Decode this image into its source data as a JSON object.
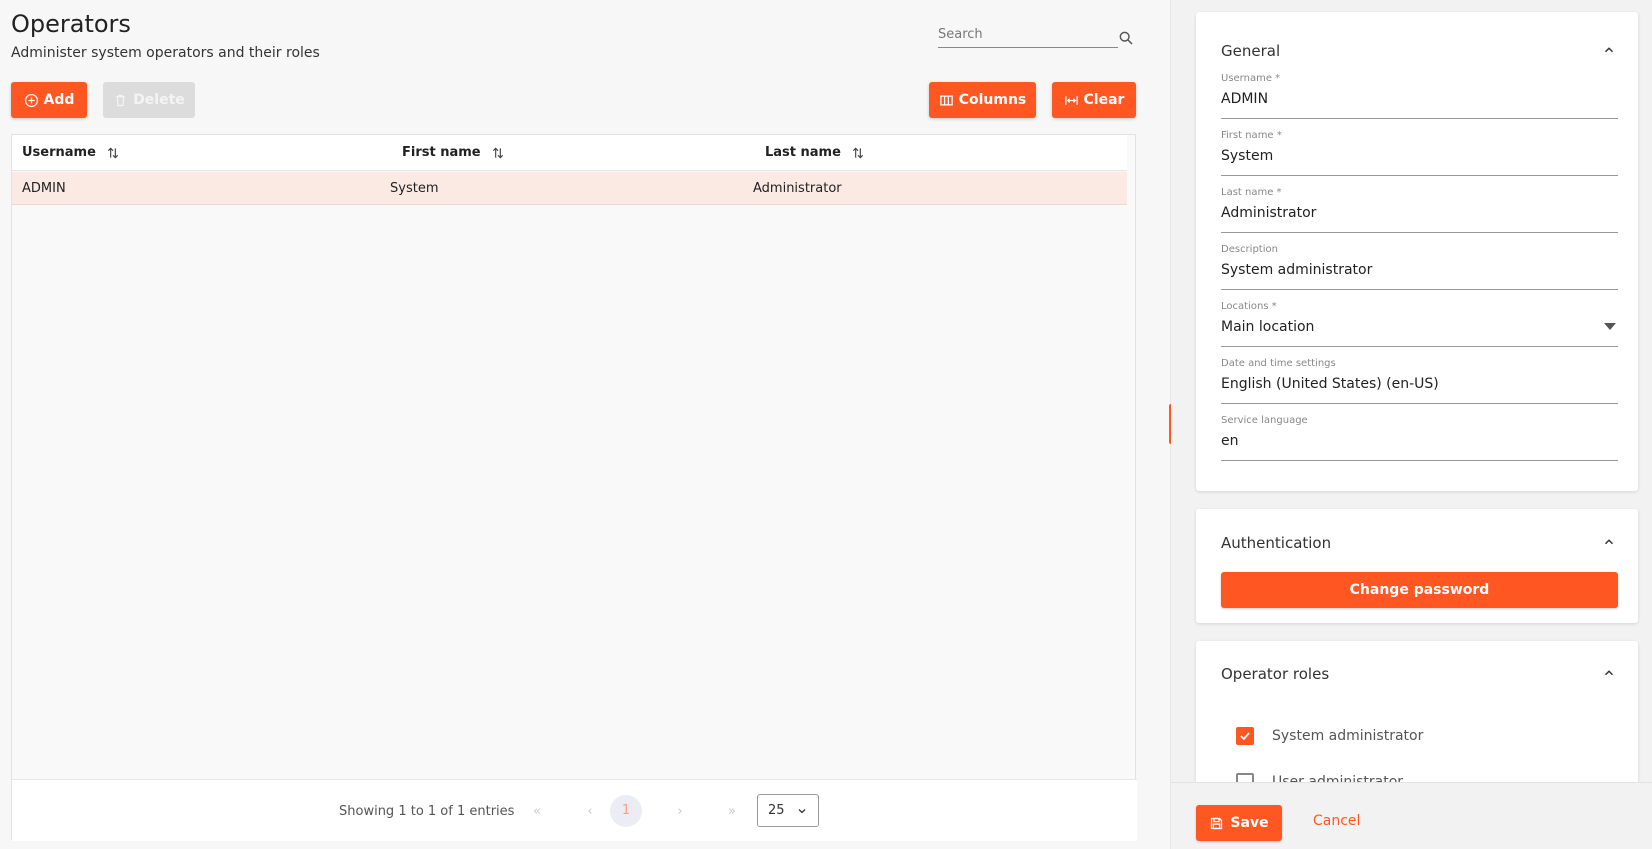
{
  "header": {
    "title": "Operators",
    "subtitle": "Administer system operators and their roles",
    "search_placeholder": "Search"
  },
  "toolbar": {
    "add_label": "Add",
    "delete_label": "Delete",
    "columns_label": "Columns",
    "clear_label": "Clear"
  },
  "table": {
    "columns": [
      "Username",
      "First name",
      "Last name"
    ],
    "rows": [
      [
        "ADMIN",
        "System",
        "Administrator"
      ]
    ]
  },
  "pagination": {
    "info": "Showing 1 to 1 of 1 entries",
    "first": "«",
    "prev": "‹",
    "current": "1",
    "next": "›",
    "last": "»",
    "page_size": "25"
  },
  "general": {
    "title": "General",
    "fields": [
      {
        "label": "Username *",
        "value": "ADMIN"
      },
      {
        "label": "First name *",
        "value": "System"
      },
      {
        "label": "Last name *",
        "value": "Administrator"
      },
      {
        "label": "Description",
        "value": "System administrator"
      },
      {
        "label": "Locations *",
        "value": "Main location"
      },
      {
        "label": "Date and time settings",
        "value": "English (United States) (en-US)"
      },
      {
        "label": "Service language",
        "value": "en"
      }
    ]
  },
  "authentication": {
    "title": "Authentication",
    "change_password_label": "Change password"
  },
  "operator_roles": {
    "title": "Operator roles",
    "roles": [
      {
        "label": "System administrator",
        "checked": true
      },
      {
        "label": "User administrator",
        "checked": false
      }
    ]
  },
  "footer": {
    "save_label": "Save",
    "cancel_label": "Cancel"
  },
  "colors": {
    "accent": "#ff5722",
    "selected_row": "#fbeae4"
  }
}
